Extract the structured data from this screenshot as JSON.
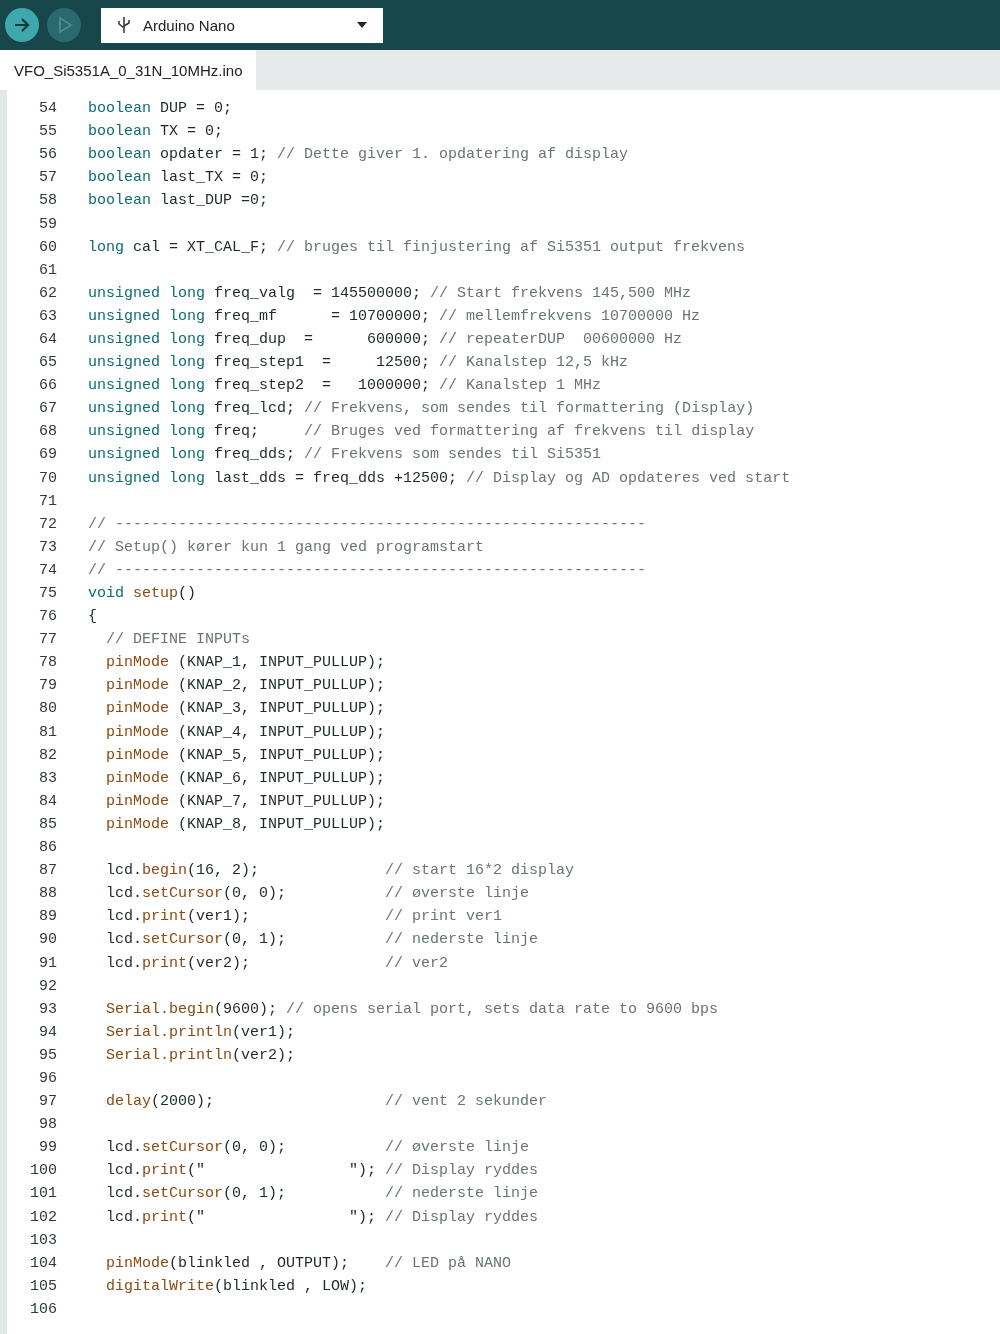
{
  "toolbar": {
    "buttons": [
      {
        "kind": "verify",
        "disabled": false
      },
      {
        "kind": "upload",
        "disabled": true
      }
    ],
    "board_selector": {
      "value": "Arduino Nano"
    }
  },
  "tabs": [
    {
      "label": "VFO_Si5351A_0_31N_10MHz.ino",
      "selected": true
    }
  ],
  "editor": {
    "lines": [
      {
        "number": "54",
        "tokens": [
          {
            "kind": "kw",
            "text": "boolean"
          },
          {
            "kind": "p",
            "text": " DUP = 0;"
          }
        ]
      },
      {
        "number": "55",
        "tokens": [
          {
            "kind": "kw",
            "text": "boolean"
          },
          {
            "kind": "p",
            "text": " TX = 0;"
          }
        ]
      },
      {
        "number": "56",
        "tokens": [
          {
            "kind": "kw",
            "text": "boolean"
          },
          {
            "kind": "p",
            "text": " opdater = 1; "
          },
          {
            "kind": "c",
            "text": "// Dette giver 1. opdatering af display"
          }
        ]
      },
      {
        "number": "57",
        "tokens": [
          {
            "kind": "kw",
            "text": "boolean"
          },
          {
            "kind": "p",
            "text": " last_TX = 0;"
          }
        ]
      },
      {
        "number": "58",
        "tokens": [
          {
            "kind": "kw",
            "text": "boolean"
          },
          {
            "kind": "p",
            "text": " last_DUP =0;"
          }
        ]
      },
      {
        "number": "59"
      },
      {
        "number": "60",
        "tokens": [
          {
            "kind": "kw",
            "text": "long"
          },
          {
            "kind": "p",
            "text": " cal = XT_CAL_F; "
          },
          {
            "kind": "c",
            "text": "// bruges til finjustering af Si5351 output frekvens"
          }
        ]
      },
      {
        "number": "61"
      },
      {
        "number": "62",
        "tokens": [
          {
            "kind": "kw",
            "text": "unsigned long"
          },
          {
            "kind": "p",
            "text": " freq_valg  = 145500000; "
          },
          {
            "kind": "c",
            "text": "// Start frekvens 145,500 MHz"
          }
        ]
      },
      {
        "number": "63",
        "tokens": [
          {
            "kind": "kw",
            "text": "unsigned long"
          },
          {
            "kind": "p",
            "text": " freq_mf      = 10700000; "
          },
          {
            "kind": "c",
            "text": "// mellemfrekvens 10700000 Hz"
          }
        ]
      },
      {
        "number": "64",
        "tokens": [
          {
            "kind": "kw",
            "text": "unsigned long"
          },
          {
            "kind": "p",
            "text": " freq_dup  =      600000; "
          },
          {
            "kind": "c",
            "text": "// repeaterDUP  00600000 Hz"
          }
        ]
      },
      {
        "number": "65",
        "tokens": [
          {
            "kind": "kw",
            "text": "unsigned long"
          },
          {
            "kind": "p",
            "text": " freq_step1  =     12500; "
          },
          {
            "kind": "c",
            "text": "// Kanalstep 12,5 kHz"
          }
        ]
      },
      {
        "number": "66",
        "tokens": [
          {
            "kind": "kw",
            "text": "unsigned long"
          },
          {
            "kind": "p",
            "text": " freq_step2  =   1000000; "
          },
          {
            "kind": "c",
            "text": "// Kanalstep 1 MHz"
          }
        ]
      },
      {
        "number": "67",
        "tokens": [
          {
            "kind": "kw",
            "text": "unsigned long"
          },
          {
            "kind": "p",
            "text": " freq_lcd; "
          },
          {
            "kind": "c",
            "text": "// Frekvens, som sendes til formattering (Display)"
          }
        ]
      },
      {
        "number": "68",
        "tokens": [
          {
            "kind": "kw",
            "text": "unsigned long"
          },
          {
            "kind": "p",
            "text": " freq;     "
          },
          {
            "kind": "c",
            "text": "// Bruges ved formattering af frekvens til display"
          }
        ]
      },
      {
        "number": "69",
        "tokens": [
          {
            "kind": "kw",
            "text": "unsigned long"
          },
          {
            "kind": "p",
            "text": " freq_dds; "
          },
          {
            "kind": "c",
            "text": "// Frekvens som sendes til Si5351"
          }
        ]
      },
      {
        "number": "70",
        "tokens": [
          {
            "kind": "kw",
            "text": "unsigned long"
          },
          {
            "kind": "p",
            "text": " last_dds = freq_dds +12500; "
          },
          {
            "kind": "c",
            "text": "// Display og AD opdateres ved start"
          }
        ]
      },
      {
        "number": "71"
      },
      {
        "number": "72",
        "tokens": [
          {
            "kind": "c",
            "text": "// -----------------------------------------------------------"
          }
        ]
      },
      {
        "number": "73",
        "tokens": [
          {
            "kind": "c",
            "text": "// Setup() kører kun 1 gang ved programstart"
          }
        ]
      },
      {
        "number": "74",
        "tokens": [
          {
            "kind": "c",
            "text": "// -----------------------------------------------------------"
          }
        ]
      },
      {
        "number": "75",
        "tokens": [
          {
            "kind": "kw",
            "text": "void "
          },
          {
            "kind": "fn",
            "text": "setup"
          },
          {
            "kind": "p",
            "text": "()"
          }
        ]
      },
      {
        "number": "76",
        "tokens": [
          {
            "kind": "p",
            "text": "{"
          }
        ]
      },
      {
        "number": "77",
        "tokens": [
          {
            "kind": "c",
            "text": "  // DEFINE INPUTs"
          }
        ]
      },
      {
        "number": "78",
        "tokens": [
          {
            "kind": "fn",
            "text": "  pinMode"
          },
          {
            "kind": "p",
            "text": " (KNAP_1, INPUT_PULLUP);"
          }
        ]
      },
      {
        "number": "79",
        "tokens": [
          {
            "kind": "fn",
            "text": "  pinMode"
          },
          {
            "kind": "p",
            "text": " (KNAP_2, INPUT_PULLUP);"
          }
        ]
      },
      {
        "number": "80",
        "tokens": [
          {
            "kind": "fn",
            "text": "  pinMode"
          },
          {
            "kind": "p",
            "text": " (KNAP_3, INPUT_PULLUP);"
          }
        ]
      },
      {
        "number": "81",
        "tokens": [
          {
            "kind": "fn",
            "text": "  pinMode"
          },
          {
            "kind": "p",
            "text": " (KNAP_4, INPUT_PULLUP);"
          }
        ]
      },
      {
        "number": "82",
        "tokens": [
          {
            "kind": "fn",
            "text": "  pinMode"
          },
          {
            "kind": "p",
            "text": " (KNAP_5, INPUT_PULLUP);"
          }
        ]
      },
      {
        "number": "83",
        "tokens": [
          {
            "kind": "fn",
            "text": "  pinMode"
          },
          {
            "kind": "p",
            "text": " (KNAP_6, INPUT_PULLUP);"
          }
        ]
      },
      {
        "number": "84",
        "tokens": [
          {
            "kind": "fn",
            "text": "  pinMode"
          },
          {
            "kind": "p",
            "text": " (KNAP_7, INPUT_PULLUP);"
          }
        ]
      },
      {
        "number": "85",
        "tokens": [
          {
            "kind": "fn",
            "text": "  pinMode"
          },
          {
            "kind": "p",
            "text": " (KNAP_8, INPUT_PULLUP);"
          }
        ]
      },
      {
        "number": "86"
      },
      {
        "number": "87",
        "tokens": [
          {
            "kind": "p",
            "text": "  lcd."
          },
          {
            "kind": "fn",
            "text": "begin"
          },
          {
            "kind": "p",
            "text": "(16, 2);              "
          },
          {
            "kind": "c",
            "text": "// start 16*2 display"
          }
        ]
      },
      {
        "number": "88",
        "tokens": [
          {
            "kind": "p",
            "text": "  lcd."
          },
          {
            "kind": "fn",
            "text": "setCursor"
          },
          {
            "kind": "p",
            "text": "(0, 0);           "
          },
          {
            "kind": "c",
            "text": "// øverste linje"
          }
        ]
      },
      {
        "number": "89",
        "tokens": [
          {
            "kind": "p",
            "text": "  lcd."
          },
          {
            "kind": "fn",
            "text": "print"
          },
          {
            "kind": "p",
            "text": "(ver1);               "
          },
          {
            "kind": "c",
            "text": "// print ver1"
          }
        ]
      },
      {
        "number": "90",
        "tokens": [
          {
            "kind": "p",
            "text": "  lcd."
          },
          {
            "kind": "fn",
            "text": "setCursor"
          },
          {
            "kind": "p",
            "text": "(0, 1);           "
          },
          {
            "kind": "c",
            "text": "// nederste linje"
          }
        ]
      },
      {
        "number": "91",
        "tokens": [
          {
            "kind": "p",
            "text": "  lcd."
          },
          {
            "kind": "fn",
            "text": "print"
          },
          {
            "kind": "p",
            "text": "(ver2);               "
          },
          {
            "kind": "c",
            "text": "// ver2"
          }
        ]
      },
      {
        "number": "92"
      },
      {
        "number": "93",
        "tokens": [
          {
            "kind": "fn",
            "text": "  Serial.begin"
          },
          {
            "kind": "p",
            "text": "(9600); "
          },
          {
            "kind": "c",
            "text": "// opens serial port, sets data rate to 9600 bps"
          }
        ]
      },
      {
        "number": "94",
        "tokens": [
          {
            "kind": "fn",
            "text": "  Serial.println"
          },
          {
            "kind": "p",
            "text": "(ver1);"
          }
        ]
      },
      {
        "number": "95",
        "tokens": [
          {
            "kind": "fn",
            "text": "  Serial.println"
          },
          {
            "kind": "p",
            "text": "(ver2);"
          }
        ]
      },
      {
        "number": "96"
      },
      {
        "number": "97",
        "tokens": [
          {
            "kind": "fn",
            "text": "  delay"
          },
          {
            "kind": "p",
            "text": "(2000);                   "
          },
          {
            "kind": "c",
            "text": "// vent 2 sekunder"
          }
        ]
      },
      {
        "number": "98"
      },
      {
        "number": "99",
        "tokens": [
          {
            "kind": "p",
            "text": "  lcd."
          },
          {
            "kind": "fn",
            "text": "setCursor"
          },
          {
            "kind": "p",
            "text": "(0, 0);           "
          },
          {
            "kind": "c",
            "text": "// øverste linje"
          }
        ]
      },
      {
        "number": "100",
        "tokens": [
          {
            "kind": "p",
            "text": "  lcd."
          },
          {
            "kind": "fn",
            "text": "print"
          },
          {
            "kind": "p",
            "text": "(\"                \"); "
          },
          {
            "kind": "c",
            "text": "// Display ryddes"
          }
        ]
      },
      {
        "number": "101",
        "tokens": [
          {
            "kind": "p",
            "text": "  lcd."
          },
          {
            "kind": "fn",
            "text": "setCursor"
          },
          {
            "kind": "p",
            "text": "(0, 1);           "
          },
          {
            "kind": "c",
            "text": "// nederste linje"
          }
        ]
      },
      {
        "number": "102",
        "tokens": [
          {
            "kind": "p",
            "text": "  lcd."
          },
          {
            "kind": "fn",
            "text": "print"
          },
          {
            "kind": "p",
            "text": "(\"                \"); "
          },
          {
            "kind": "c",
            "text": "// Display ryddes"
          }
        ]
      },
      {
        "number": "103"
      },
      {
        "number": "104",
        "tokens": [
          {
            "kind": "fn",
            "text": "  pinMode"
          },
          {
            "kind": "p",
            "text": "(blinkled , OUTPUT);    "
          },
          {
            "kind": "c",
            "text": "// LED på NANO"
          }
        ]
      },
      {
        "number": "105",
        "tokens": [
          {
            "kind": "fn",
            "text": "  digitalWrite"
          },
          {
            "kind": "p",
            "text": "(blinkled , LOW);"
          }
        ]
      },
      {
        "number": "106"
      }
    ]
  }
}
